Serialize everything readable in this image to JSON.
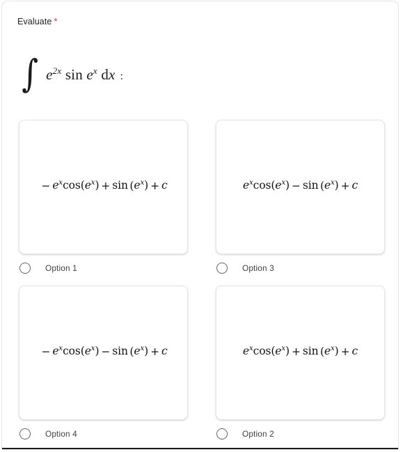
{
  "question": {
    "title": "Evaluate",
    "required_marker": "*",
    "expression_plain": "∫ e^{2x} sin e^{x} dx :",
    "integral_symbol": "∫",
    "integrand_base": "e",
    "integrand_exponent": "2x",
    "function_name": "sin",
    "function_arg_base": "e",
    "function_arg_exponent": "x",
    "differential": "d",
    "differential_var": "x",
    "trailing_colon": ":"
  },
  "options": [
    {
      "label": "Option 1",
      "expression_plain": "−e^{x}cos(e^{x}) + sin (e^{x}) + c",
      "leading_sign": "−",
      "first_term_fn": "cos",
      "middle_operator": "+",
      "second_term_fn": "sin",
      "constant": "c",
      "selected": false
    },
    {
      "label": "Option 3",
      "expression_plain": "e^{x}cos(e^{x}) − sin (e^{x}) + c",
      "leading_sign": "",
      "first_term_fn": "cos",
      "middle_operator": "−",
      "second_term_fn": "sin",
      "constant": "c",
      "selected": false
    },
    {
      "label": "Option 4",
      "expression_plain": "−e^{x}cos(e^{x}) − sin (e^{x}) + c",
      "leading_sign": "−",
      "first_term_fn": "cos",
      "middle_operator": "−",
      "second_term_fn": "sin",
      "constant": "c",
      "selected": false
    },
    {
      "label": "Option 2",
      "expression_plain": "e^{x}cos(e^{x}) + sin (e^{x}) + c",
      "leading_sign": "",
      "first_term_fn": "cos",
      "middle_operator": "+",
      "second_term_fn": "sin",
      "constant": "c",
      "selected": false
    }
  ],
  "symbols": {
    "exp_base": "e",
    "exponent": "x",
    "open_paren": "(",
    "close_paren": ")",
    "plus": "+",
    "minus": "−"
  },
  "colors": {
    "required_red": "#d93025",
    "title_text": "#202124",
    "label_text": "#3c4043",
    "radio_ring": "#5f6368",
    "card_border": "#e6e6e6",
    "form_border": "#e4e3ec",
    "page_background": "#ffffff"
  }
}
